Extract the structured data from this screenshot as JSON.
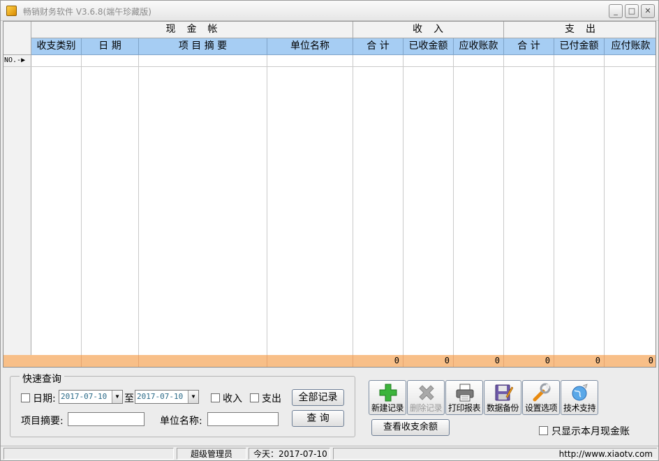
{
  "window": {
    "title": "畅销财务软件 V3.6.8(端午珍藏版)",
    "controls": {
      "minimize": "_",
      "maximize": "□",
      "close": "✕"
    }
  },
  "grid": {
    "group_headers": [
      "现　金　帐",
      "收　入",
      "支　出"
    ],
    "columns": [
      "收支类别",
      "日 期",
      "项 目 摘 要",
      "单位名称",
      "合 计",
      "已收金额",
      "应收账款",
      "合 计",
      "已付金额",
      "应付账款"
    ],
    "row_header_first": "NO.-",
    "row_marker": "▶",
    "totals": [
      "0",
      "0",
      "0",
      "0",
      "0",
      "0"
    ]
  },
  "quick_query": {
    "title": "快速查询",
    "date_label": "日期:",
    "date_from": "2017-07-10",
    "to_label": "至",
    "date_to": "2017-07-10",
    "income_label": "收入",
    "expense_label": "支出",
    "all_records_button": "全部记录",
    "summary_label": "项目摘要:",
    "unit_label": "单位名称:",
    "query_button": "查 询"
  },
  "toolbar": {
    "new_record": "新建记录",
    "delete_record": "删除记录",
    "print_report": "打印报表",
    "data_backup": "数据备份",
    "settings": "设置选项",
    "tech_support": "技术支持",
    "view_balance": "查看收支余额",
    "month_only_label": "只显示本月现金账"
  },
  "statusbar": {
    "user": "超级管理员",
    "today": "今天：2017-07-10",
    "website": "http://www.xiaotv.com"
  },
  "colors": {
    "header_blue": "#a6cdf3",
    "totals_orange": "#f8bf88"
  }
}
